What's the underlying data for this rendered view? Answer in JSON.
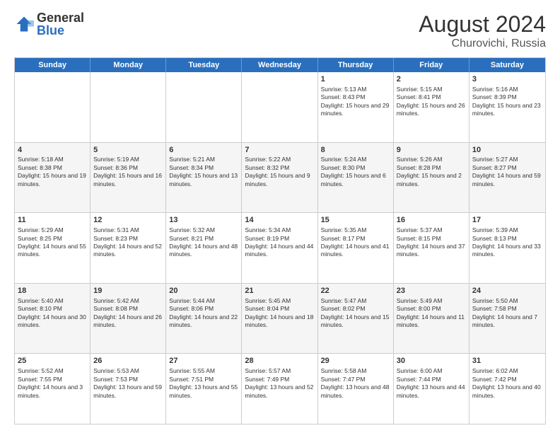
{
  "logo": {
    "general": "General",
    "blue": "Blue"
  },
  "header": {
    "month_year": "August 2024",
    "location": "Churovichi, Russia"
  },
  "days": [
    "Sunday",
    "Monday",
    "Tuesday",
    "Wednesday",
    "Thursday",
    "Friday",
    "Saturday"
  ],
  "rows": [
    [
      {
        "day": "",
        "sunrise": "",
        "sunset": "",
        "daylight": ""
      },
      {
        "day": "",
        "sunrise": "",
        "sunset": "",
        "daylight": ""
      },
      {
        "day": "",
        "sunrise": "",
        "sunset": "",
        "daylight": ""
      },
      {
        "day": "",
        "sunrise": "",
        "sunset": "",
        "daylight": ""
      },
      {
        "day": "1",
        "sunrise": "Sunrise: 5:13 AM",
        "sunset": "Sunset: 8:43 PM",
        "daylight": "Daylight: 15 hours and 29 minutes."
      },
      {
        "day": "2",
        "sunrise": "Sunrise: 5:15 AM",
        "sunset": "Sunset: 8:41 PM",
        "daylight": "Daylight: 15 hours and 26 minutes."
      },
      {
        "day": "3",
        "sunrise": "Sunrise: 5:16 AM",
        "sunset": "Sunset: 8:39 PM",
        "daylight": "Daylight: 15 hours and 23 minutes."
      }
    ],
    [
      {
        "day": "4",
        "sunrise": "Sunrise: 5:18 AM",
        "sunset": "Sunset: 8:38 PM",
        "daylight": "Daylight: 15 hours and 19 minutes."
      },
      {
        "day": "5",
        "sunrise": "Sunrise: 5:19 AM",
        "sunset": "Sunset: 8:36 PM",
        "daylight": "Daylight: 15 hours and 16 minutes."
      },
      {
        "day": "6",
        "sunrise": "Sunrise: 5:21 AM",
        "sunset": "Sunset: 8:34 PM",
        "daylight": "Daylight: 15 hours and 13 minutes."
      },
      {
        "day": "7",
        "sunrise": "Sunrise: 5:22 AM",
        "sunset": "Sunset: 8:32 PM",
        "daylight": "Daylight: 15 hours and 9 minutes."
      },
      {
        "day": "8",
        "sunrise": "Sunrise: 5:24 AM",
        "sunset": "Sunset: 8:30 PM",
        "daylight": "Daylight: 15 hours and 6 minutes."
      },
      {
        "day": "9",
        "sunrise": "Sunrise: 5:26 AM",
        "sunset": "Sunset: 8:28 PM",
        "daylight": "Daylight: 15 hours and 2 minutes."
      },
      {
        "day": "10",
        "sunrise": "Sunrise: 5:27 AM",
        "sunset": "Sunset: 8:27 PM",
        "daylight": "Daylight: 14 hours and 59 minutes."
      }
    ],
    [
      {
        "day": "11",
        "sunrise": "Sunrise: 5:29 AM",
        "sunset": "Sunset: 8:25 PM",
        "daylight": "Daylight: 14 hours and 55 minutes."
      },
      {
        "day": "12",
        "sunrise": "Sunrise: 5:31 AM",
        "sunset": "Sunset: 8:23 PM",
        "daylight": "Daylight: 14 hours and 52 minutes."
      },
      {
        "day": "13",
        "sunrise": "Sunrise: 5:32 AM",
        "sunset": "Sunset: 8:21 PM",
        "daylight": "Daylight: 14 hours and 48 minutes."
      },
      {
        "day": "14",
        "sunrise": "Sunrise: 5:34 AM",
        "sunset": "Sunset: 8:19 PM",
        "daylight": "Daylight: 14 hours and 44 minutes."
      },
      {
        "day": "15",
        "sunrise": "Sunrise: 5:35 AM",
        "sunset": "Sunset: 8:17 PM",
        "daylight": "Daylight: 14 hours and 41 minutes."
      },
      {
        "day": "16",
        "sunrise": "Sunrise: 5:37 AM",
        "sunset": "Sunset: 8:15 PM",
        "daylight": "Daylight: 14 hours and 37 minutes."
      },
      {
        "day": "17",
        "sunrise": "Sunrise: 5:39 AM",
        "sunset": "Sunset: 8:13 PM",
        "daylight": "Daylight: 14 hours and 33 minutes."
      }
    ],
    [
      {
        "day": "18",
        "sunrise": "Sunrise: 5:40 AM",
        "sunset": "Sunset: 8:10 PM",
        "daylight": "Daylight: 14 hours and 30 minutes."
      },
      {
        "day": "19",
        "sunrise": "Sunrise: 5:42 AM",
        "sunset": "Sunset: 8:08 PM",
        "daylight": "Daylight: 14 hours and 26 minutes."
      },
      {
        "day": "20",
        "sunrise": "Sunrise: 5:44 AM",
        "sunset": "Sunset: 8:06 PM",
        "daylight": "Daylight: 14 hours and 22 minutes."
      },
      {
        "day": "21",
        "sunrise": "Sunrise: 5:45 AM",
        "sunset": "Sunset: 8:04 PM",
        "daylight": "Daylight: 14 hours and 18 minutes."
      },
      {
        "day": "22",
        "sunrise": "Sunrise: 5:47 AM",
        "sunset": "Sunset: 8:02 PM",
        "daylight": "Daylight: 14 hours and 15 minutes."
      },
      {
        "day": "23",
        "sunrise": "Sunrise: 5:49 AM",
        "sunset": "Sunset: 8:00 PM",
        "daylight": "Daylight: 14 hours and 11 minutes."
      },
      {
        "day": "24",
        "sunrise": "Sunrise: 5:50 AM",
        "sunset": "Sunset: 7:58 PM",
        "daylight": "Daylight: 14 hours and 7 minutes."
      }
    ],
    [
      {
        "day": "25",
        "sunrise": "Sunrise: 5:52 AM",
        "sunset": "Sunset: 7:55 PM",
        "daylight": "Daylight: 14 hours and 3 minutes."
      },
      {
        "day": "26",
        "sunrise": "Sunrise: 5:53 AM",
        "sunset": "Sunset: 7:53 PM",
        "daylight": "Daylight: 13 hours and 59 minutes."
      },
      {
        "day": "27",
        "sunrise": "Sunrise: 5:55 AM",
        "sunset": "Sunset: 7:51 PM",
        "daylight": "Daylight: 13 hours and 55 minutes."
      },
      {
        "day": "28",
        "sunrise": "Sunrise: 5:57 AM",
        "sunset": "Sunset: 7:49 PM",
        "daylight": "Daylight: 13 hours and 52 minutes."
      },
      {
        "day": "29",
        "sunrise": "Sunrise: 5:58 AM",
        "sunset": "Sunset: 7:47 PM",
        "daylight": "Daylight: 13 hours and 48 minutes."
      },
      {
        "day": "30",
        "sunrise": "Sunrise: 6:00 AM",
        "sunset": "Sunset: 7:44 PM",
        "daylight": "Daylight: 13 hours and 44 minutes."
      },
      {
        "day": "31",
        "sunrise": "Sunrise: 6:02 AM",
        "sunset": "Sunset: 7:42 PM",
        "daylight": "Daylight: 13 hours and 40 minutes."
      }
    ]
  ]
}
